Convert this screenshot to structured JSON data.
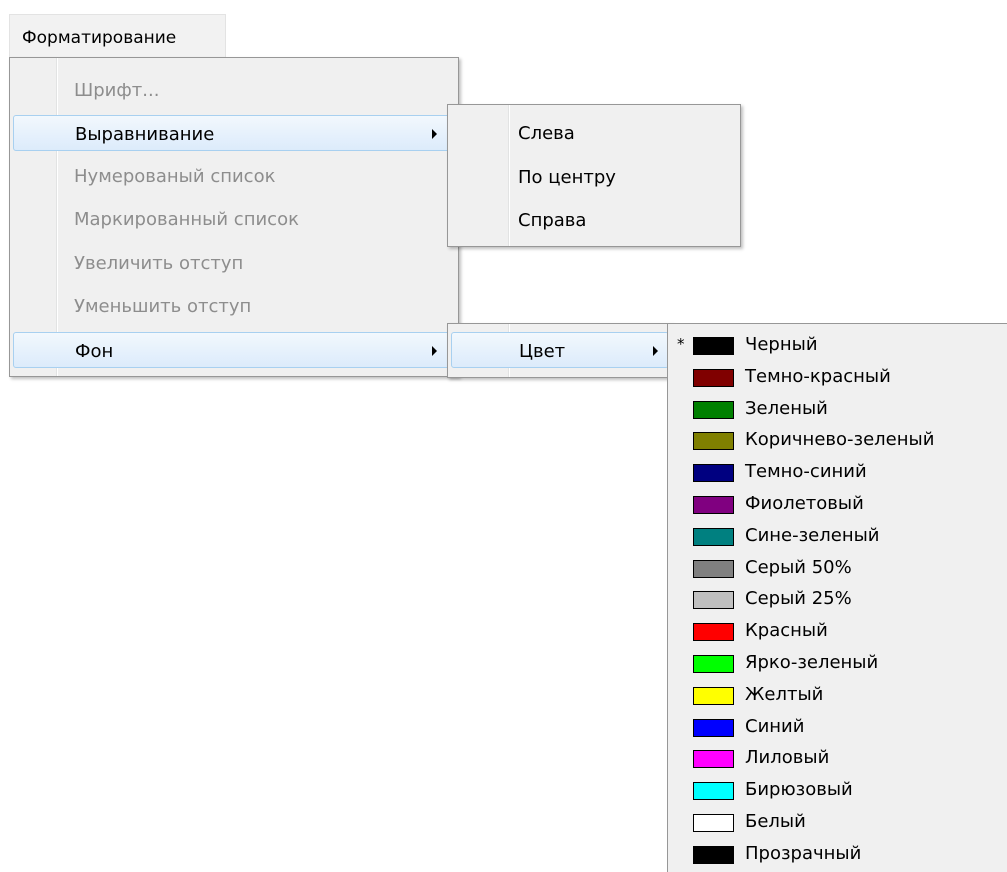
{
  "menubar": {
    "format_label": "Форматирование"
  },
  "main_menu": {
    "items": [
      {
        "label": "Шрифт...",
        "enabled": false
      },
      {
        "label": "Выравнивание",
        "enabled": true
      },
      {
        "label": "Нумерованый список",
        "enabled": false
      },
      {
        "label": "Маркированный список",
        "enabled": false
      },
      {
        "label": "Увеличить отступ",
        "enabled": false
      },
      {
        "label": "Уменьшить отступ",
        "enabled": false
      },
      {
        "label": "Фон",
        "enabled": true
      }
    ]
  },
  "align_menu": {
    "items": [
      {
        "label": "Слева"
      },
      {
        "label": "По центру"
      },
      {
        "label": "Справа"
      }
    ]
  },
  "background_menu": {
    "items": [
      {
        "label": "Цвет"
      }
    ]
  },
  "color_menu": {
    "selected_marker": "*",
    "items": [
      {
        "label": "Черный",
        "color": "#000000"
      },
      {
        "label": "Темно-красный",
        "color": "#800000"
      },
      {
        "label": "Зеленый",
        "color": "#008000"
      },
      {
        "label": "Коричнево-зеленый",
        "color": "#808000"
      },
      {
        "label": "Темно-синий",
        "color": "#000080"
      },
      {
        "label": "Фиолетовый",
        "color": "#800080"
      },
      {
        "label": "Сине-зеленый",
        "color": "#008080"
      },
      {
        "label": "Серый 50%",
        "color": "#808080"
      },
      {
        "label": "Серый 25%",
        "color": "#c0c0c0"
      },
      {
        "label": "Красный",
        "color": "#ff0000"
      },
      {
        "label": "Ярко-зеленый",
        "color": "#00ff00"
      },
      {
        "label": "Желтый",
        "color": "#ffff00"
      },
      {
        "label": "Синий",
        "color": "#0000ff"
      },
      {
        "label": "Лиловый",
        "color": "#ff00ff"
      },
      {
        "label": "Бирюзовый",
        "color": "#00ffff"
      },
      {
        "label": "Белый",
        "color": "#ffffff"
      },
      {
        "label": "Прозрачный",
        "color": "#000000"
      }
    ]
  }
}
